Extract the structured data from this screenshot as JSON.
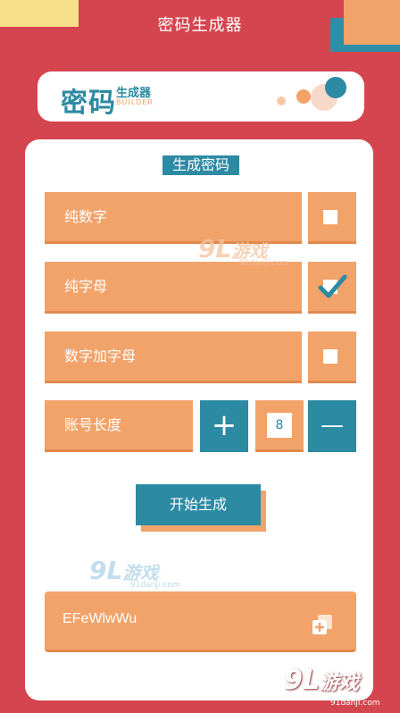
{
  "header": {
    "title": "密码生成器"
  },
  "logo": {
    "main": "密码",
    "sub": "生成器",
    "sub_en": "BUILDER"
  },
  "panel": {
    "title": "生成密码"
  },
  "options": [
    {
      "label": "纯数字",
      "checked": false
    },
    {
      "label": "纯字母",
      "checked": true
    },
    {
      "label": "数字加字母",
      "checked": false
    }
  ],
  "length": {
    "label": "账号长度",
    "plus": "+",
    "value": "8",
    "minus": "—"
  },
  "actions": {
    "generate": "开始生成"
  },
  "result": {
    "value": "EFeWlwWu"
  },
  "watermarks": {
    "brand_num": "9",
    "brand_l": "L",
    "brand_text": "游戏",
    "url": "91danji.com"
  },
  "colors": {
    "background": "#d4454f",
    "accent": "#2c8aa3",
    "orange": "#f2a36a",
    "card": "#ffffff"
  },
  "icons": {
    "checkbox_checked": "check-icon",
    "copy": "copy-icon"
  }
}
